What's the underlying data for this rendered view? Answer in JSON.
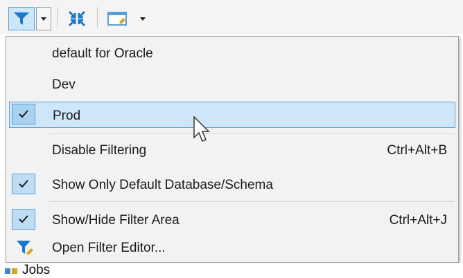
{
  "toolbar": {
    "buttons": [
      {
        "icon": "filter-icon"
      },
      {
        "icon": "dropdown-arrow-icon"
      },
      {
        "icon": "collapse-tree-icon"
      },
      {
        "icon": "new-window-icon"
      },
      {
        "icon": "dropdown-arrow-icon"
      }
    ]
  },
  "menu": {
    "items": [
      {
        "label": "default for Oracle",
        "checked": false,
        "shortcut": ""
      },
      {
        "label": "Dev",
        "checked": false,
        "shortcut": ""
      },
      {
        "label": "Prod",
        "checked": true,
        "highlighted": true,
        "shortcut": ""
      },
      {
        "label": "Disable Filtering",
        "checked": false,
        "shortcut": "Ctrl+Alt+B"
      },
      {
        "label": "Show Only Default Database/Schema",
        "checked": true,
        "shortcut": ""
      },
      {
        "label": "Show/Hide Filter Area",
        "checked": true,
        "shortcut": "Ctrl+Alt+J"
      },
      {
        "label": "Open Filter Editor...",
        "checked": false,
        "icon": "filter-editor-icon",
        "shortcut": ""
      }
    ]
  },
  "tree": {
    "partial_item_label": "Jobs",
    "partial_item_icon": "jobs-icon"
  },
  "colors": {
    "highlight_bg": "#cde6fa",
    "highlight_border": "#5b9fd8",
    "filter_icon": "#1b78c9"
  }
}
